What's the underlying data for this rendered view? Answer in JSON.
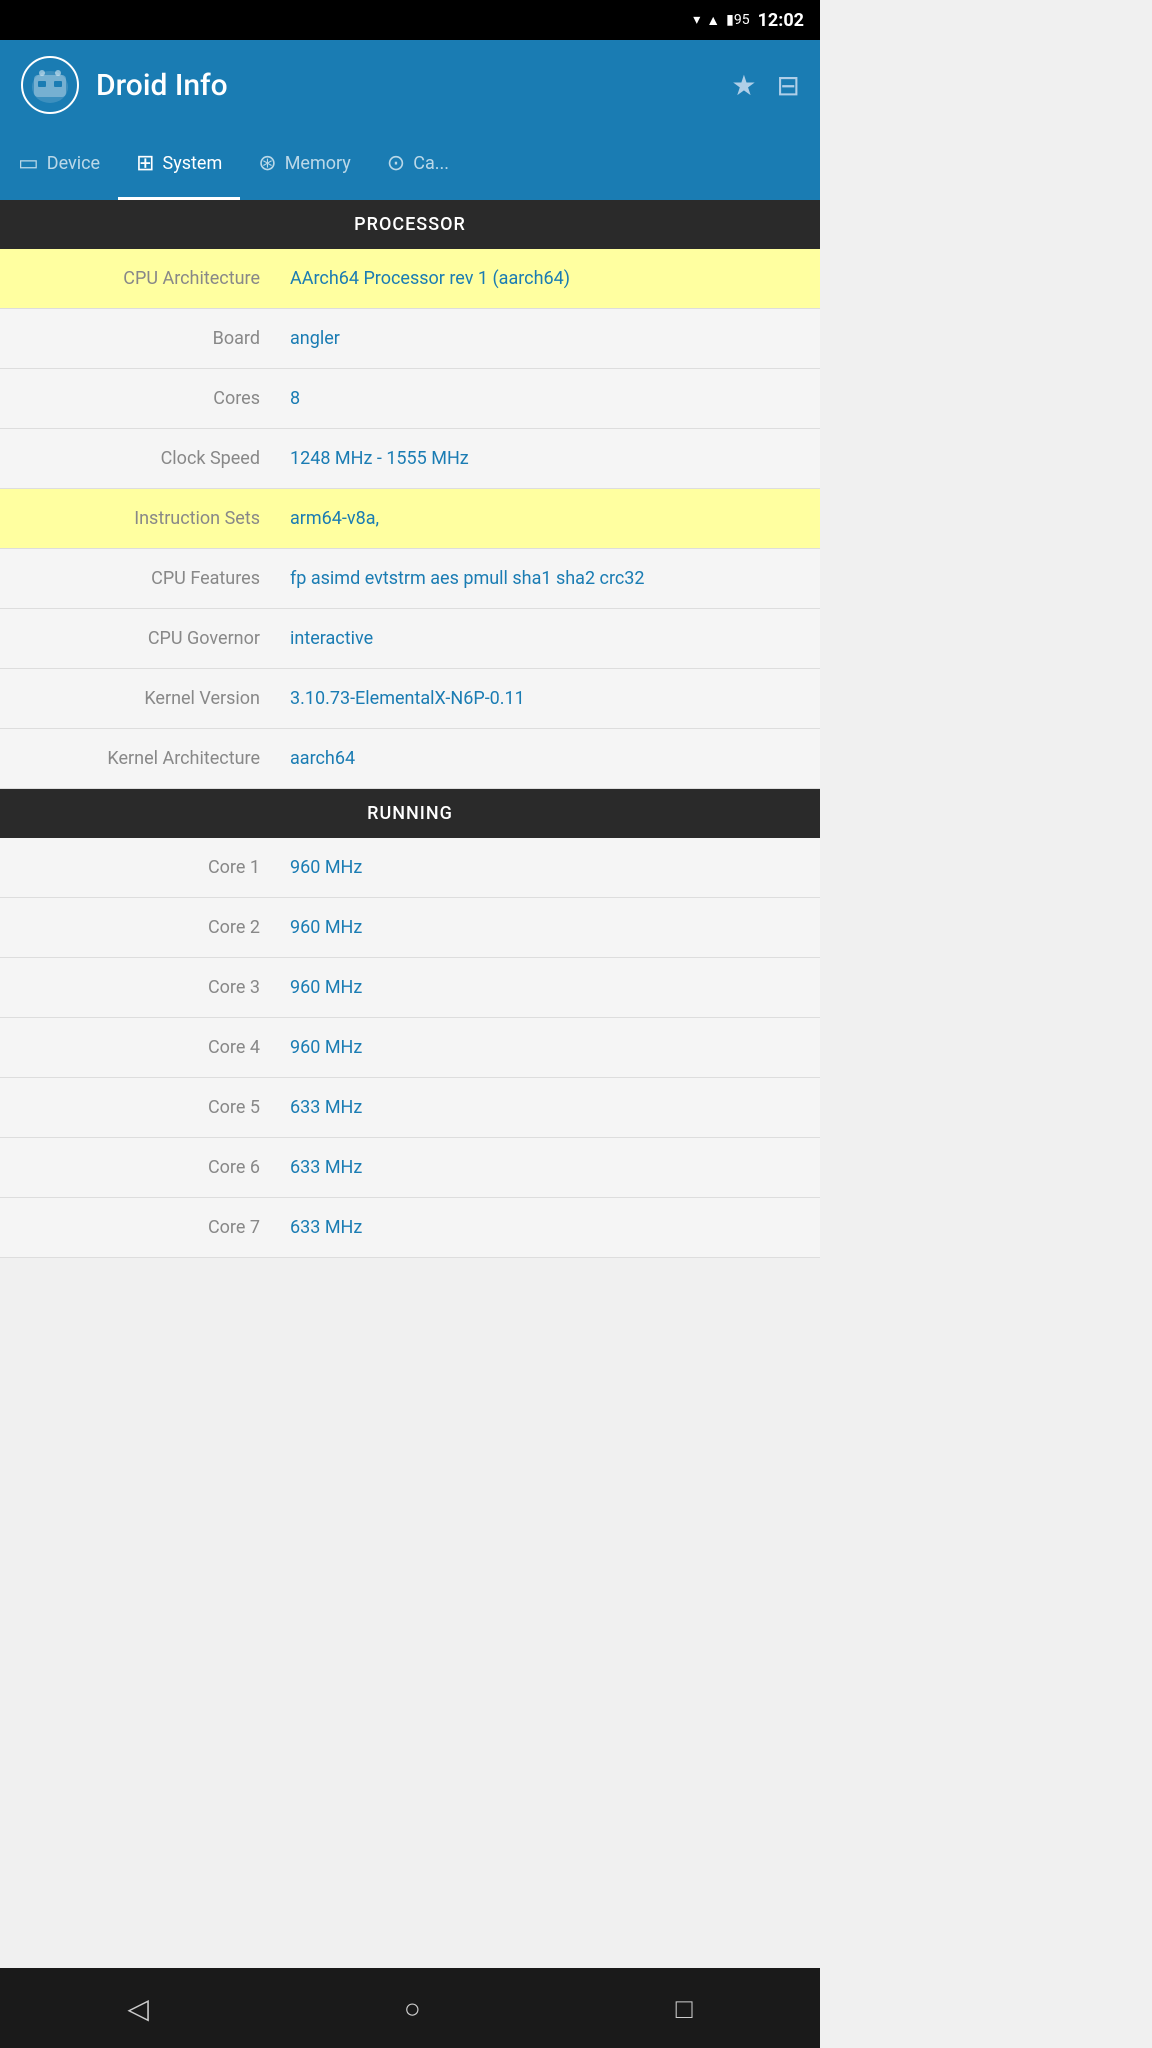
{
  "statusBar": {
    "time": "12:02",
    "batteryLevel": "95"
  },
  "appBar": {
    "title": "Droid Info",
    "starIcon": "★",
    "settingsIcon": "⊟"
  },
  "tabs": [
    {
      "id": "device",
      "label": "Device",
      "icon": "device"
    },
    {
      "id": "system",
      "label": "System",
      "icon": "system",
      "active": true
    },
    {
      "id": "memory",
      "label": "Memory",
      "icon": "memory"
    },
    {
      "id": "camera",
      "label": "Ca...",
      "icon": "camera"
    }
  ],
  "sections": {
    "processor": {
      "header": "PROCESSOR",
      "rows": [
        {
          "label": "CPU Architecture",
          "value": "AArch64 Processor rev 1 (aarch64)",
          "highlighted": true
        },
        {
          "label": "Board",
          "value": "angler",
          "highlighted": false
        },
        {
          "label": "Cores",
          "value": "8",
          "highlighted": false
        },
        {
          "label": "Clock Speed",
          "value": "1248 MHz - 1555 MHz",
          "highlighted": false
        },
        {
          "label": "Instruction Sets",
          "value": "arm64-v8a,",
          "highlighted": true
        },
        {
          "label": "CPU Features",
          "value": "fp asimd evtstrm aes pmull sha1 sha2 crc32",
          "highlighted": false
        },
        {
          "label": "CPU Governor",
          "value": "interactive",
          "highlighted": false
        },
        {
          "label": "Kernel Version",
          "value": "3.10.73-ElementalX-N6P-0.11",
          "highlighted": false
        },
        {
          "label": "Kernel Architecture",
          "value": "aarch64",
          "highlighted": false
        }
      ]
    },
    "running": {
      "header": "RUNNING",
      "rows": [
        {
          "label": "Core 1",
          "value": "960 MHz"
        },
        {
          "label": "Core 2",
          "value": "960 MHz"
        },
        {
          "label": "Core 3",
          "value": "960 MHz"
        },
        {
          "label": "Core 4",
          "value": "960 MHz"
        },
        {
          "label": "Core 5",
          "value": "633 MHz"
        },
        {
          "label": "Core 6",
          "value": "633 MHz"
        },
        {
          "label": "Core 7",
          "value": "633 MHz"
        }
      ]
    }
  },
  "navBar": {
    "backIcon": "◁",
    "homeIcon": "○",
    "recentIcon": "□"
  }
}
